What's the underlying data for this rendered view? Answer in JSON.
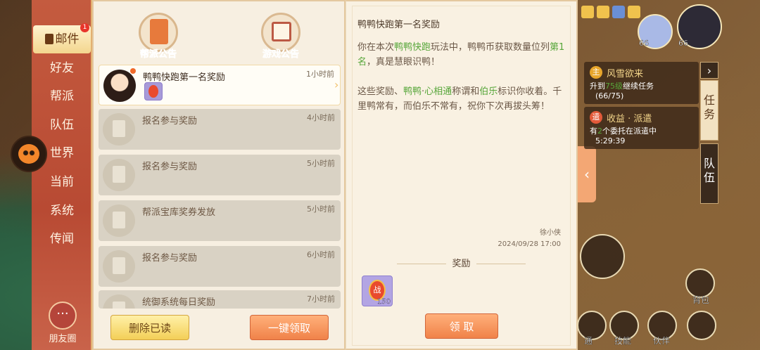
{
  "nav": {
    "items": [
      {
        "label": "邮件",
        "badge": "1",
        "active": true
      },
      {
        "label": "好友"
      },
      {
        "label": "帮派"
      },
      {
        "label": "队伍"
      },
      {
        "label": "世界"
      },
      {
        "label": "当前"
      },
      {
        "label": "系统"
      },
      {
        "label": "传闻"
      }
    ],
    "friends_label": "朋友圈"
  },
  "tabs": [
    {
      "label": "帮派公告"
    },
    {
      "label": "游戏公告"
    }
  ],
  "mails": [
    {
      "title": "鸭鸭快跑第一名奖励",
      "time": "1小时前"
    },
    {
      "title": "报名参与奖励",
      "time": "4小时前"
    },
    {
      "title": "报名参与奖励",
      "time": "5小时前"
    },
    {
      "title": "帮派宝库奖券发放",
      "time": "5小时前"
    },
    {
      "title": "报名参与奖励",
      "time": "6小时前"
    },
    {
      "title": "统御系统每日奖励",
      "time": "7小时前"
    }
  ],
  "list_buttons": {
    "delete_read": "删除已读",
    "claim_all": "一键领取"
  },
  "detail": {
    "title": "鸭鸭快跑第一名奖励",
    "p1_a": "你在本次",
    "p1_hl1": "鸭鸭快跑",
    "p1_b": "玩法中，鸭鸭币获取数量位列",
    "p1_hl2": "第1名",
    "p1_c": "，真是慧眼识鸭！",
    "p2_a": "这些奖励、",
    "p2_hl1": "鸭鸭",
    "p2_b": "·",
    "p2_hl2": "心相通",
    "p2_c": "称谓和",
    "p2_hl3": "伯乐",
    "p2_d": "标识你收着。千里鸭常有，而伯乐不常有，祝你下次再拔头筹！",
    "sender": "徐小侠",
    "date": "2024/09/28 17:00",
    "rewards_label": "奖励",
    "reward_item": {
      "glyph": "战",
      "count": "150"
    },
    "claim_button": "领 取"
  },
  "hud": {
    "hero_levels": [
      "66",
      "66"
    ],
    "quests": [
      {
        "icon": "主",
        "name": "风雪欲来",
        "line1_a": "升到",
        "line1_hl": "75级",
        "line1_b": "继续任务",
        "line2": "(66/75)"
      },
      {
        "icon": "遣",
        "name": "收益 · 派遣",
        "line1_a": "有",
        "line1_hl": "2",
        "line1_b": "个委托在派遣中",
        "line2": "5:29:39"
      }
    ],
    "side_tabs": [
      "任务",
      "队伍"
    ],
    "bottom": [
      "通",
      "技能",
      "伙伴"
    ],
    "bag_label": "背包"
  },
  "colors": {
    "accent_orange": "#f08249",
    "highlight_green": "#57a63a",
    "nav_red": "#c45b3f"
  }
}
